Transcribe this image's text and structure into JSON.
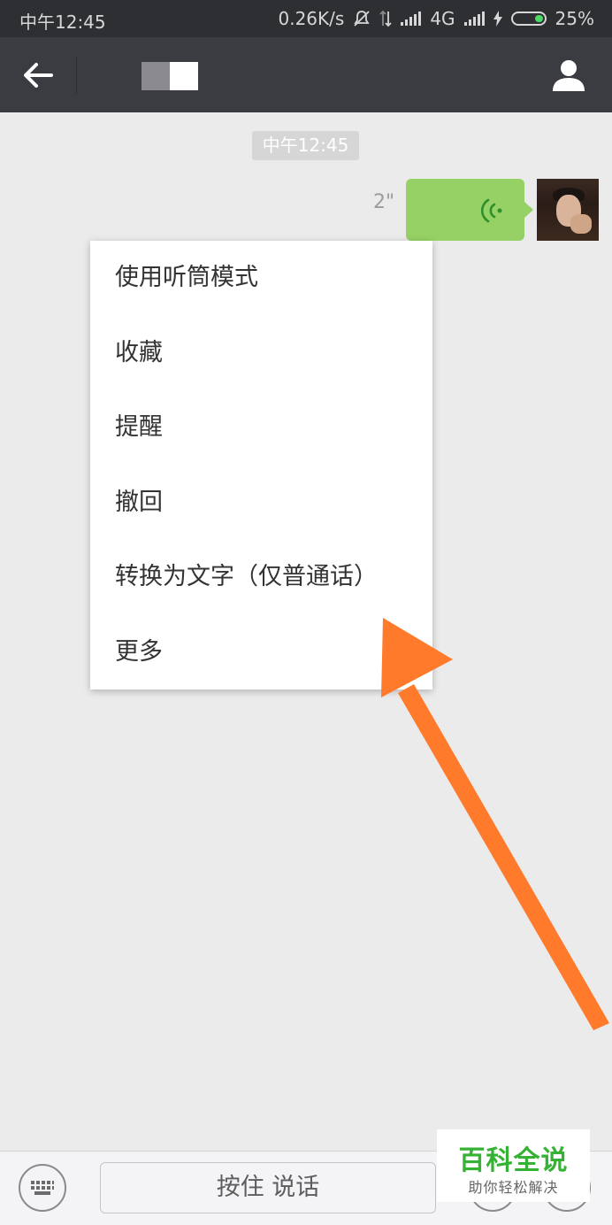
{
  "status_bar": {
    "time": "中午12:45",
    "network_speed": "0.26K/s",
    "network_type": "4G",
    "battery_percent": "25%",
    "battery_level": 0.25
  },
  "header": {
    "back_icon": "arrow-left-icon",
    "profile_icon": "person-icon"
  },
  "chat": {
    "timestamp": "中午12:45",
    "voice_message": {
      "duration": "2\"",
      "icon": "voice-wave-icon",
      "bubble_color": "#95d164"
    }
  },
  "context_menu": {
    "items": [
      {
        "label": "使用听筒模式"
      },
      {
        "label": "收藏"
      },
      {
        "label": "提醒"
      },
      {
        "label": "撤回"
      },
      {
        "label": "转换为文字（仅普通话）"
      },
      {
        "label": "更多"
      }
    ]
  },
  "annotation": {
    "arrow_color": "#ff7a2a"
  },
  "input_bar": {
    "keyboard_icon": "keyboard-icon",
    "hold_to_talk_label": "按住 说话",
    "emoji_icon": "emoji-icon",
    "plus_icon": "plus-icon"
  },
  "watermark": {
    "title": "百科全说",
    "subtitle": "助你轻松解决",
    "color": "#35b234"
  }
}
